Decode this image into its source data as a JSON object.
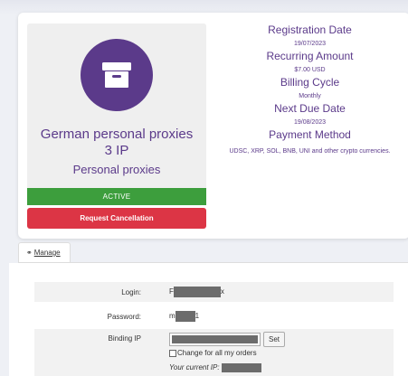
{
  "product": {
    "name_line1": "German personal proxies",
    "name_line2": "3 IP",
    "group": "Personal proxies",
    "status": "ACTIVE",
    "cancel_label": "Request Cancellation",
    "icon": "archive-box-icon",
    "colors": {
      "brand": "#5b3a8a",
      "active": "#3d9e3d",
      "danger": "#dc3545"
    }
  },
  "details": {
    "registration_label": "Registration Date",
    "registration_value": "19/07/2023",
    "recurring_label": "Recurring Amount",
    "recurring_value": "$7.00 USD",
    "billing_label": "Billing Cycle",
    "billing_value": "Monthly",
    "due_label": "Next Due Date",
    "due_value": "19/08/2023",
    "payment_label": "Payment Method",
    "payment_value": "UDSC, XRP, SOL, BNB, UNI and other crypto currencies."
  },
  "tabs": [
    {
      "label": "Manage",
      "icon": "globe-icon"
    }
  ],
  "manage": {
    "login_label": "Login:",
    "login_prefix": "F",
    "login_suffix": "x",
    "password_label": "Password:",
    "password_prefix": "m",
    "password_suffix": "1",
    "binding_label": "Binding IP",
    "set_label": "Set",
    "change_all_label": "Change for all my orders",
    "current_ip_label": "Your current IP:"
  }
}
